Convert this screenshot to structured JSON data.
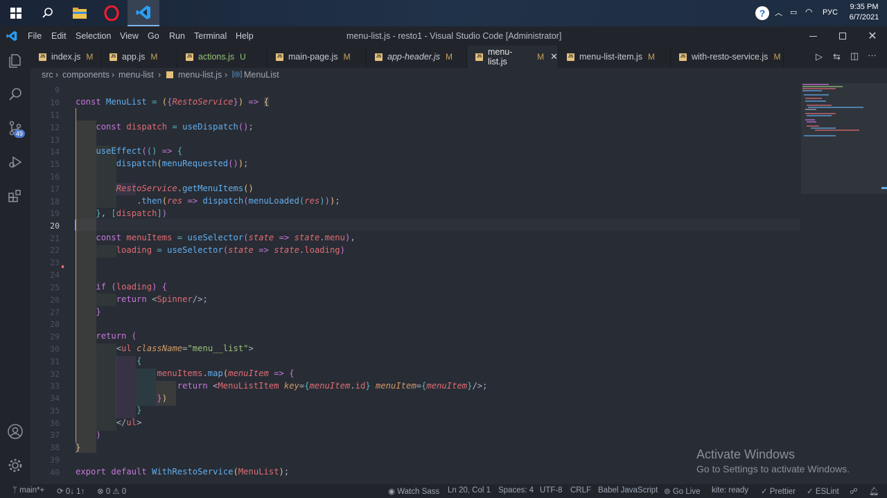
{
  "taskbar": {
    "time": "9:35 PM",
    "date": "6/7/2021",
    "lang": "РУС"
  },
  "window": {
    "title": "menu-list.js - resto1 - Visual Studio Code [Administrator]",
    "menu": [
      "File",
      "Edit",
      "Selection",
      "View",
      "Go",
      "Run",
      "Terminal",
      "Help"
    ]
  },
  "activity": {
    "scm_badge": "49"
  },
  "tabs": [
    {
      "name": "index.js",
      "status": "M"
    },
    {
      "name": "app.js",
      "status": "M"
    },
    {
      "name": "actions.js",
      "status": "U"
    },
    {
      "name": "main-page.js",
      "status": "M"
    },
    {
      "name": "app-header.js",
      "status": "M"
    },
    {
      "name": "menu-list.js",
      "status": "M"
    },
    {
      "name": "menu-list-item.js",
      "status": "M"
    },
    {
      "name": "with-resto-service.js",
      "status": "M"
    }
  ],
  "breadcrumb": {
    "p1": "src",
    "p2": "components",
    "p3": "menu-list",
    "p4": "menu-list.js",
    "p5": "MenuList"
  },
  "editor": {
    "line_numbers": [
      "9",
      "10",
      "11",
      "12",
      "13",
      "14",
      "15",
      "16",
      "17",
      "18",
      "19",
      "20",
      "21",
      "22",
      "23",
      "24",
      "25",
      "26",
      "27",
      "28",
      "29",
      "30",
      "31",
      "32",
      "33",
      "34",
      "35",
      "36",
      "37",
      "38",
      "39",
      "40"
    ]
  },
  "statusbar": {
    "branch": "main*+",
    "sync": "0↓ 1↑",
    "problems": "⊗ 0 ⚠ 0",
    "watch": "Watch Sass",
    "position": "Ln 20, Col 1",
    "spaces": "Spaces: 4",
    "encoding": "UTF-8",
    "eol": "CRLF",
    "lang": "Babel JavaScript",
    "golive": "Go Live",
    "kite": "kite: ready",
    "prettier": "Prettier",
    "eslint": "ESLint"
  },
  "watermark": {
    "line1": "Activate Windows",
    "line2": "Go to Settings to activate Windows."
  }
}
